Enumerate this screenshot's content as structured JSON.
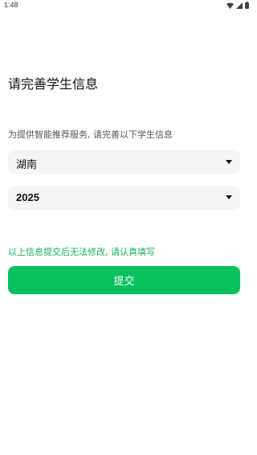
{
  "status_bar": {
    "time": "1:48",
    "icons": [
      "wifi-icon",
      "signal-icon",
      "battery-icon"
    ]
  },
  "page": {
    "title": "请完善学生信息",
    "subtitle": "为提供智能推荐服务, 请完善以下学生信息"
  },
  "form": {
    "province": {
      "selected": "湖南"
    },
    "year": {
      "selected": "2025"
    },
    "notice": "以上信息提交后无法修改, 请认真填写",
    "submit_label": "提交"
  },
  "colors": {
    "accent": "#07c160",
    "notice_text": "#12b454",
    "field_background": "#f5f5f5"
  }
}
